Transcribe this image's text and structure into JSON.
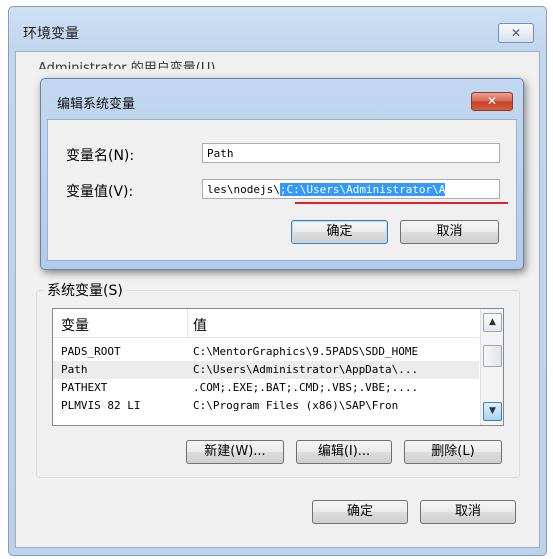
{
  "outer_window": {
    "title": "环境变量",
    "close_glyph": "✕",
    "obscured_text": "Administrator 的用户变量(U)"
  },
  "system_vars": {
    "group_title": "系统变量(S)",
    "columns": [
      "变量",
      "值"
    ],
    "rows": [
      {
        "name": "PADS_ROOT",
        "value": "C:\\MentorGraphics\\9.5PADS\\SDD_HOME"
      },
      {
        "name": "Path",
        "value": "C:\\Users\\Administrator\\AppData\\..."
      },
      {
        "name": "PATHEXT",
        "value": ".COM;.EXE;.BAT;.CMD;.VBS;.VBE;...."
      },
      {
        "name": "PLMVIS_82_LI",
        "value": "C:\\Program Files (x86)\\SAP\\Fron"
      }
    ],
    "new_button": "新建(W)...",
    "edit_button": "编辑(I)...",
    "delete_button": "删除(L)"
  },
  "footer": {
    "ok_button": "确定",
    "cancel_button": "取消"
  },
  "edit_dialog": {
    "title": "编辑系统变量",
    "close_glyph": "✕",
    "name_label": "变量名(N):",
    "name_value": "Path",
    "value_label": "变量值(V):",
    "value_prefix": "les\\nodejs\\",
    "value_selected": ";C:\\Users\\Administrator\\A",
    "ok_button": "确定",
    "cancel_button": "取消"
  },
  "colors": {
    "selection": "#3399ff",
    "annotation_underline": "#e0242c"
  }
}
